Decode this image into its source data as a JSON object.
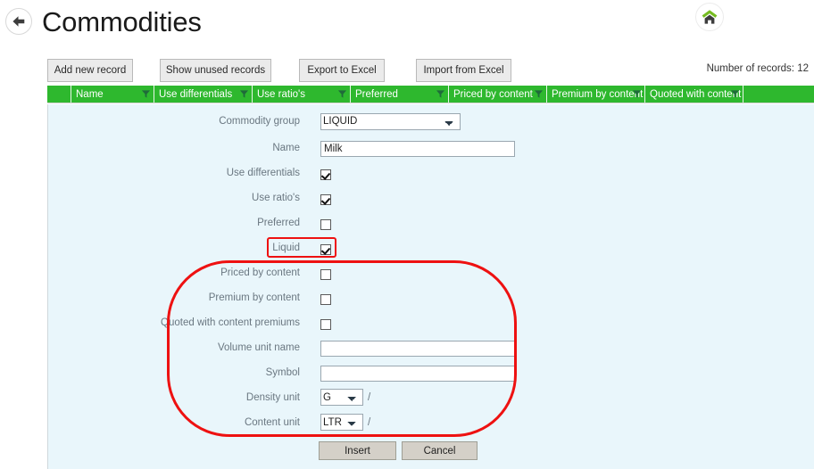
{
  "header": {
    "title": "Commodities",
    "back_icon": "back-arrow-icon",
    "home_icon": "home-icon"
  },
  "toolbar": {
    "buttons": [
      {
        "label": "Add new record"
      },
      {
        "label": "Show unused records"
      },
      {
        "label": "Export to Excel"
      },
      {
        "label": "Import from Excel"
      }
    ],
    "record_count_text": "Number of records: 12"
  },
  "grid": {
    "columns": [
      {
        "label": "",
        "filter": false
      },
      {
        "label": "Name",
        "filter": true
      },
      {
        "label": "Use differentials",
        "filter": true
      },
      {
        "label": "Use ratio's",
        "filter": true
      },
      {
        "label": "Preferred",
        "filter": true
      },
      {
        "label": "Priced by content",
        "filter": true
      },
      {
        "label": "Premium by content",
        "filter": true
      },
      {
        "label": "Quoted with content pr",
        "filter": true
      },
      {
        "label": "",
        "filter": false
      }
    ]
  },
  "form": {
    "fields": [
      {
        "label": "Commodity group",
        "type": "select",
        "value": "LIQUID"
      },
      {
        "label": "Name",
        "type": "text",
        "value": "Milk",
        "placeholder": ""
      },
      {
        "label": "Use differentials",
        "type": "checkbox",
        "checked": true
      },
      {
        "label": "Use ratio's",
        "type": "checkbox",
        "checked": true
      },
      {
        "label": "Preferred",
        "type": "checkbox",
        "checked": false
      },
      {
        "label": "Liquid",
        "type": "checkbox",
        "checked": true
      },
      {
        "label": "Priced by content",
        "type": "checkbox",
        "checked": false
      },
      {
        "label": "Premium by content",
        "type": "checkbox",
        "checked": false
      },
      {
        "label": "Quoted with content premiums",
        "type": "checkbox",
        "checked": false
      },
      {
        "label": "Volume unit name",
        "type": "text",
        "value": "",
        "placeholder": ""
      },
      {
        "label": "Symbol",
        "type": "text",
        "value": "",
        "placeholder": ""
      },
      {
        "label": "Density unit",
        "type": "select",
        "value": "G",
        "suffix": "/"
      },
      {
        "label": "Content unit",
        "type": "select",
        "value": "LTR",
        "suffix": "/"
      }
    ],
    "select_options": {
      "commodity_group": [
        "LIQUID"
      ],
      "density_unit": [
        "G"
      ],
      "content_unit": [
        "LTR"
      ]
    },
    "buttons": {
      "insert_label": "Insert",
      "cancel_label": "Cancel"
    }
  },
  "annotations": {
    "highlight_color": "#ee1111",
    "rect_target": "Liquid",
    "ellipse_target": "content-fields-group"
  },
  "colors": {
    "grid_header_green": "#2eb82e",
    "form_background": "#e9f6fb",
    "toolbar_button": "#ebebeb",
    "footer_button": "#d4d0c8",
    "annotation_red": "#ee1111",
    "home_roof_green": "#76bc21"
  }
}
